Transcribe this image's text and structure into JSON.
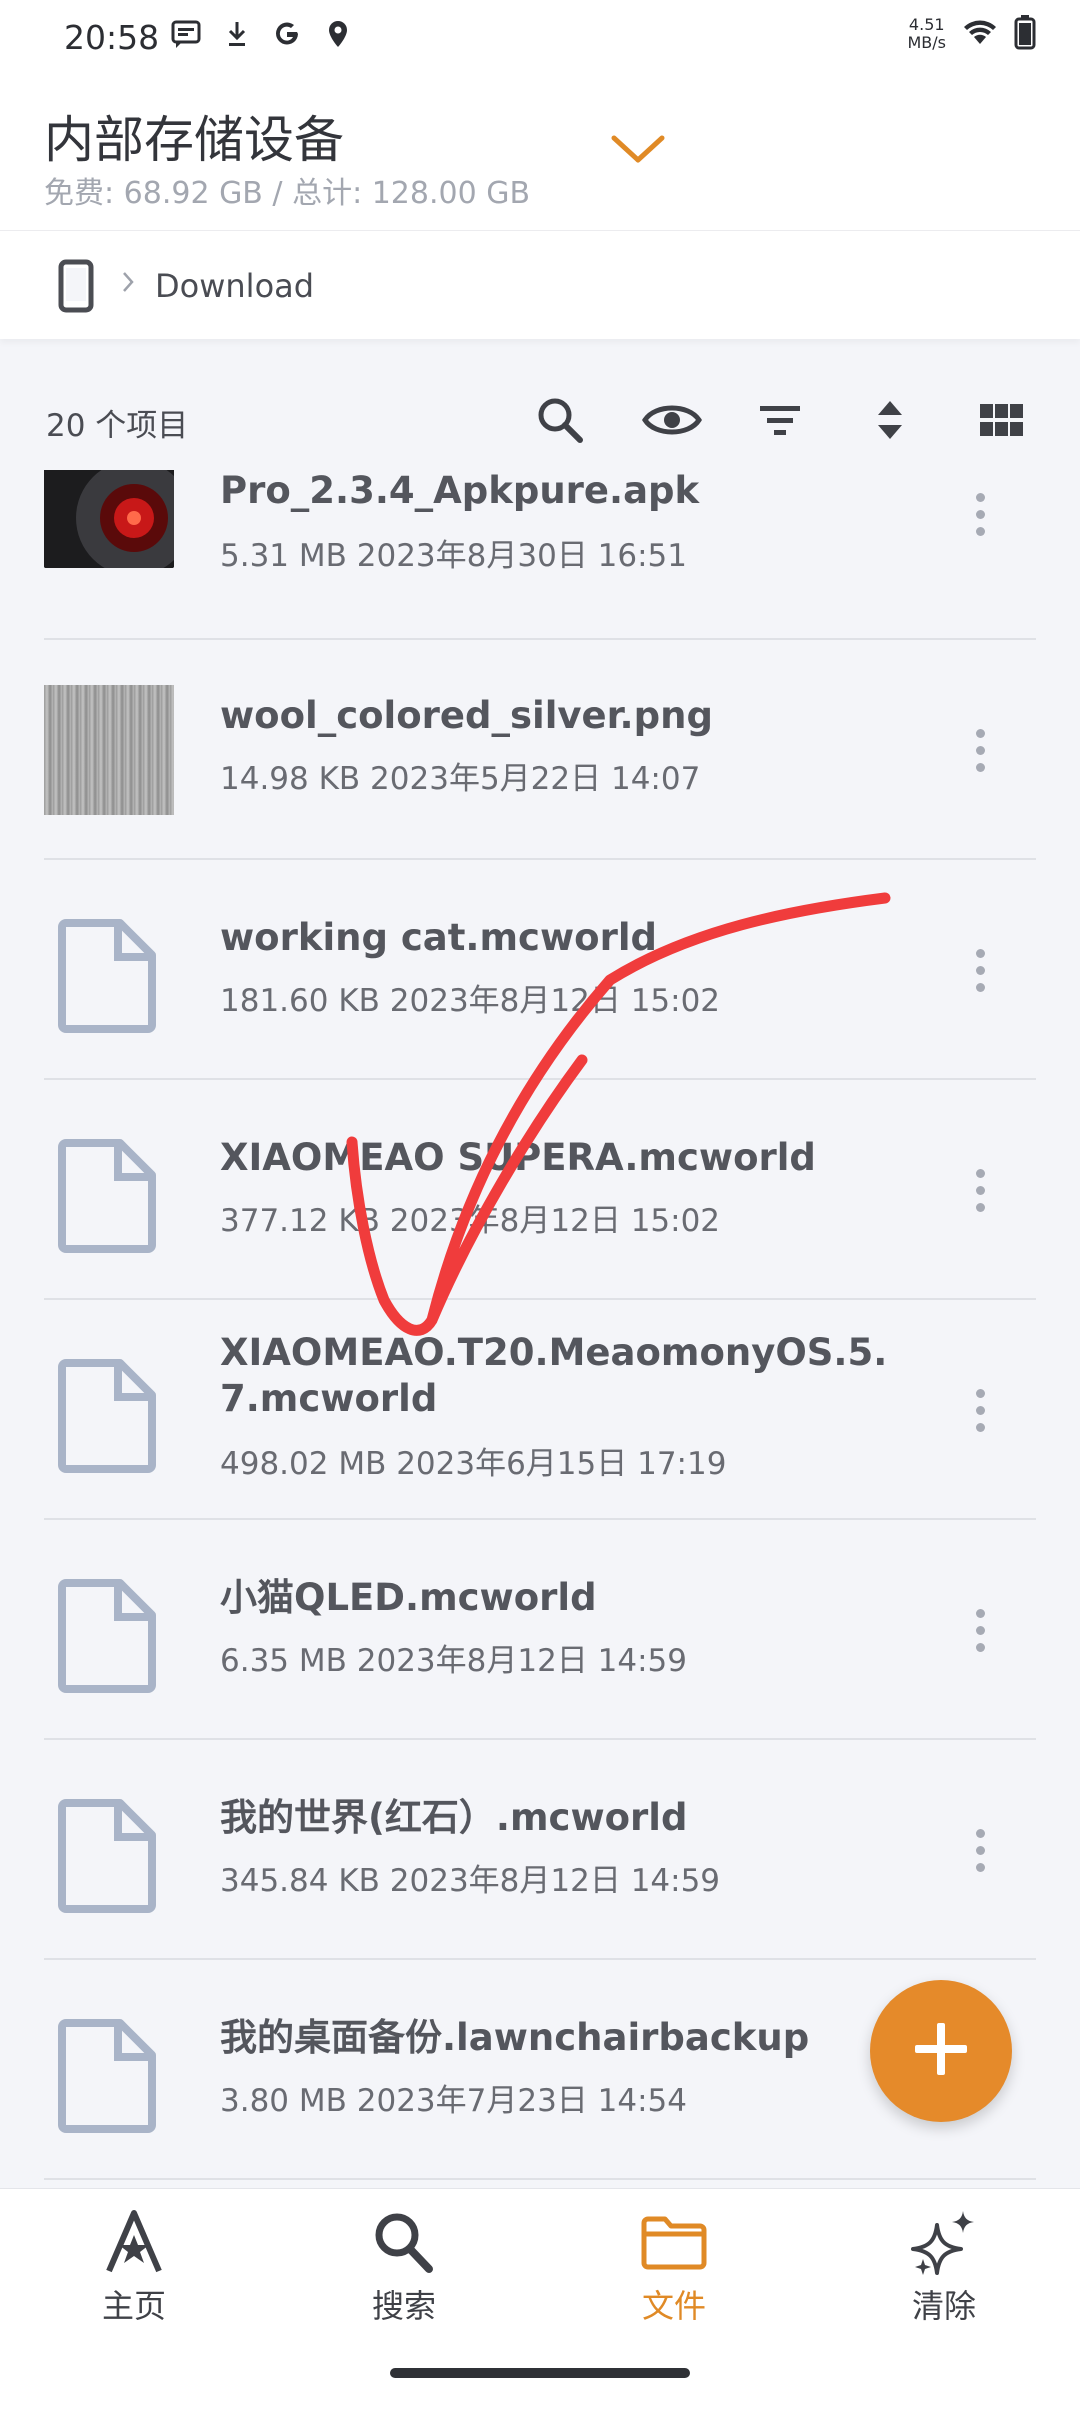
{
  "status_bar": {
    "time": "20:58",
    "net_speed_value": "4.51",
    "net_speed_unit": "MB/s",
    "left_icons": [
      "message-icon",
      "download-icon",
      "google-icon",
      "location-icon"
    ],
    "right_icons": [
      "wifi-icon",
      "battery-icon"
    ]
  },
  "header": {
    "title": "内部存储设备",
    "subtitle": "免费: 68.92 GB / 总计: 128.00 GB",
    "accent_color": "#e08a26"
  },
  "path": {
    "root_icon": "phone-icon",
    "current": "Download"
  },
  "toolbar": {
    "item_count": "20 个项目",
    "tools": [
      "search-icon",
      "eye-icon",
      "filter-icon",
      "sort-icon",
      "grid-view-icon"
    ]
  },
  "files": [
    {
      "name": "Pro_2.3.4_Apkpure.apk",
      "meta": "5.31 MB  2023年8月30日 16:51",
      "thumb": "apk-thumbnail"
    },
    {
      "name": "wool_colored_silver.png",
      "meta": "14.98 KB  2023年5月22日 14:07",
      "thumb": "image-thumbnail"
    },
    {
      "name": "working cat.mcworld",
      "meta": "181.60 KB  2023年8月12日 15:02",
      "thumb": "file-icon"
    },
    {
      "name": "XIAOMEAO SUPERA.mcworld",
      "meta": "377.12 KB  2023年8月12日 15:02",
      "thumb": "file-icon"
    },
    {
      "name": "XIAOMEAO.T20.MeaomonyOS.5.7.mcworld",
      "meta": "498.02 MB  2023年6月15日 17:19",
      "thumb": "file-icon"
    },
    {
      "name": "小猫QLED.mcworld",
      "meta": "6.35 MB  2023年8月12日 14:59",
      "thumb": "file-icon"
    },
    {
      "name": "我的世界(红石）.mcworld",
      "meta": "345.84 KB  2023年8月12日 14:59",
      "thumb": "file-icon"
    },
    {
      "name": "我的桌面备份.lawnchairbackup",
      "meta": "3.80 MB  2023年7月23日 14:54",
      "thumb": "file-icon"
    }
  ],
  "fab": {
    "icon": "plus-icon",
    "color": "#e58a2a"
  },
  "bottom_nav": [
    {
      "label": "主页",
      "icon": "home-star-icon"
    },
    {
      "label": "搜索",
      "icon": "search-icon"
    },
    {
      "label": "文件",
      "icon": "folder-icon",
      "active": true
    },
    {
      "label": "清除",
      "icon": "sparkle-icon"
    }
  ],
  "annotation": {
    "color": "#f03c3c",
    "shape": "hand-drawn check mark"
  }
}
